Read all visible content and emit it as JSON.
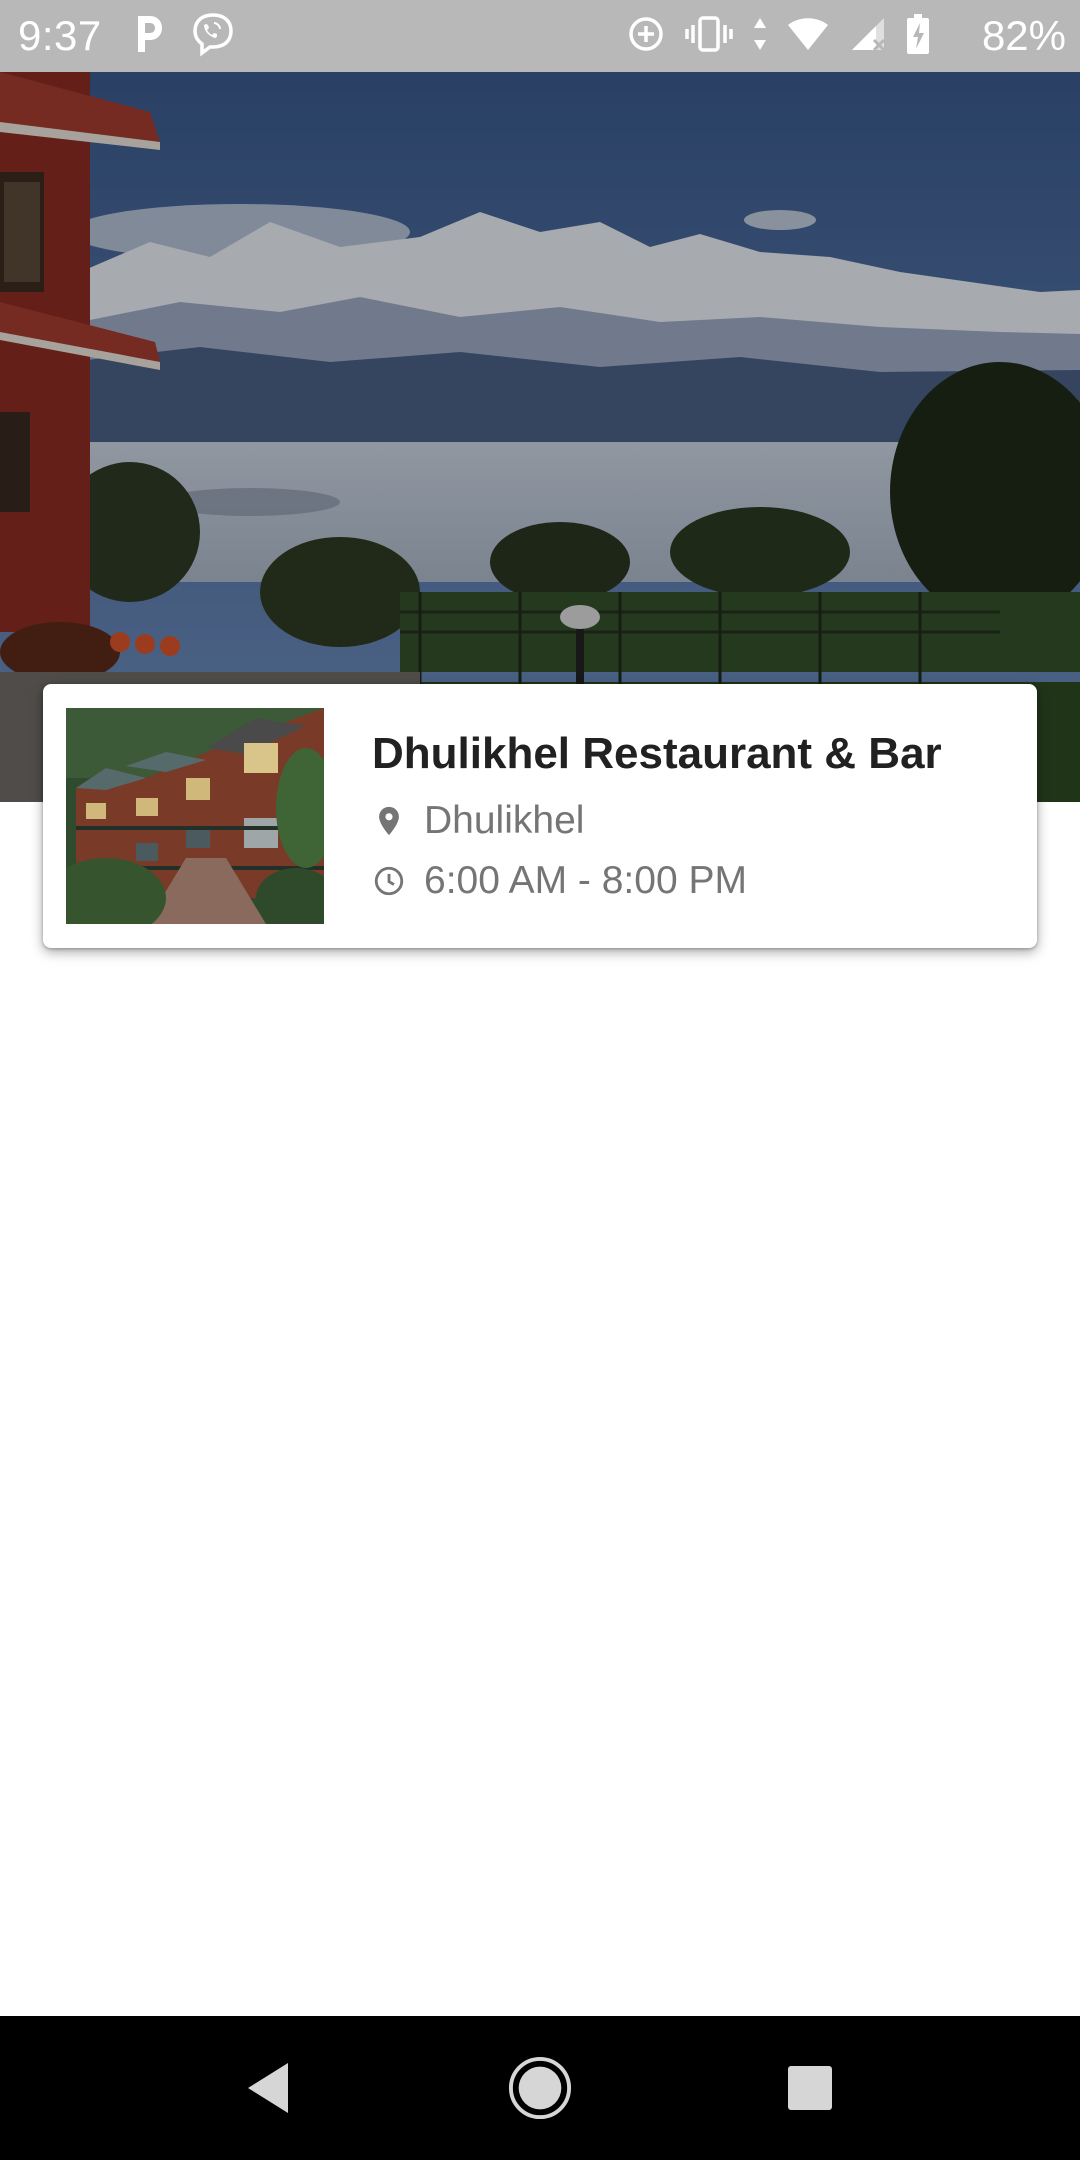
{
  "status_bar": {
    "time": "9:37",
    "battery_percent": "82%",
    "left_icons": [
      "parking-app-icon",
      "viber-icon"
    ],
    "right_icons": [
      "data-saver-icon",
      "vibrate-icon",
      "data-arrows-icon",
      "wifi-icon",
      "cell-signal-icon",
      "battery-icon"
    ]
  },
  "hero": {
    "image": "hero-landscape-image"
  },
  "restaurant": {
    "name": "Dhulikhel Restaurant & Bar",
    "location": "Dhulikhel",
    "hours": "6:00 AM - 8:00 PM",
    "thumbnail": "restaurant-thumbnail-image",
    "location_icon": "location-pin-icon",
    "hours_icon": "clock-icon"
  },
  "nav_bar": {
    "buttons": [
      "back-icon",
      "home-icon",
      "recents-icon"
    ]
  },
  "colors": {
    "status_bar": "#b8b8b8",
    "title_text": "#212121",
    "secondary_text": "#757575",
    "nav_bar": "#000000",
    "background": "#ffffff"
  }
}
